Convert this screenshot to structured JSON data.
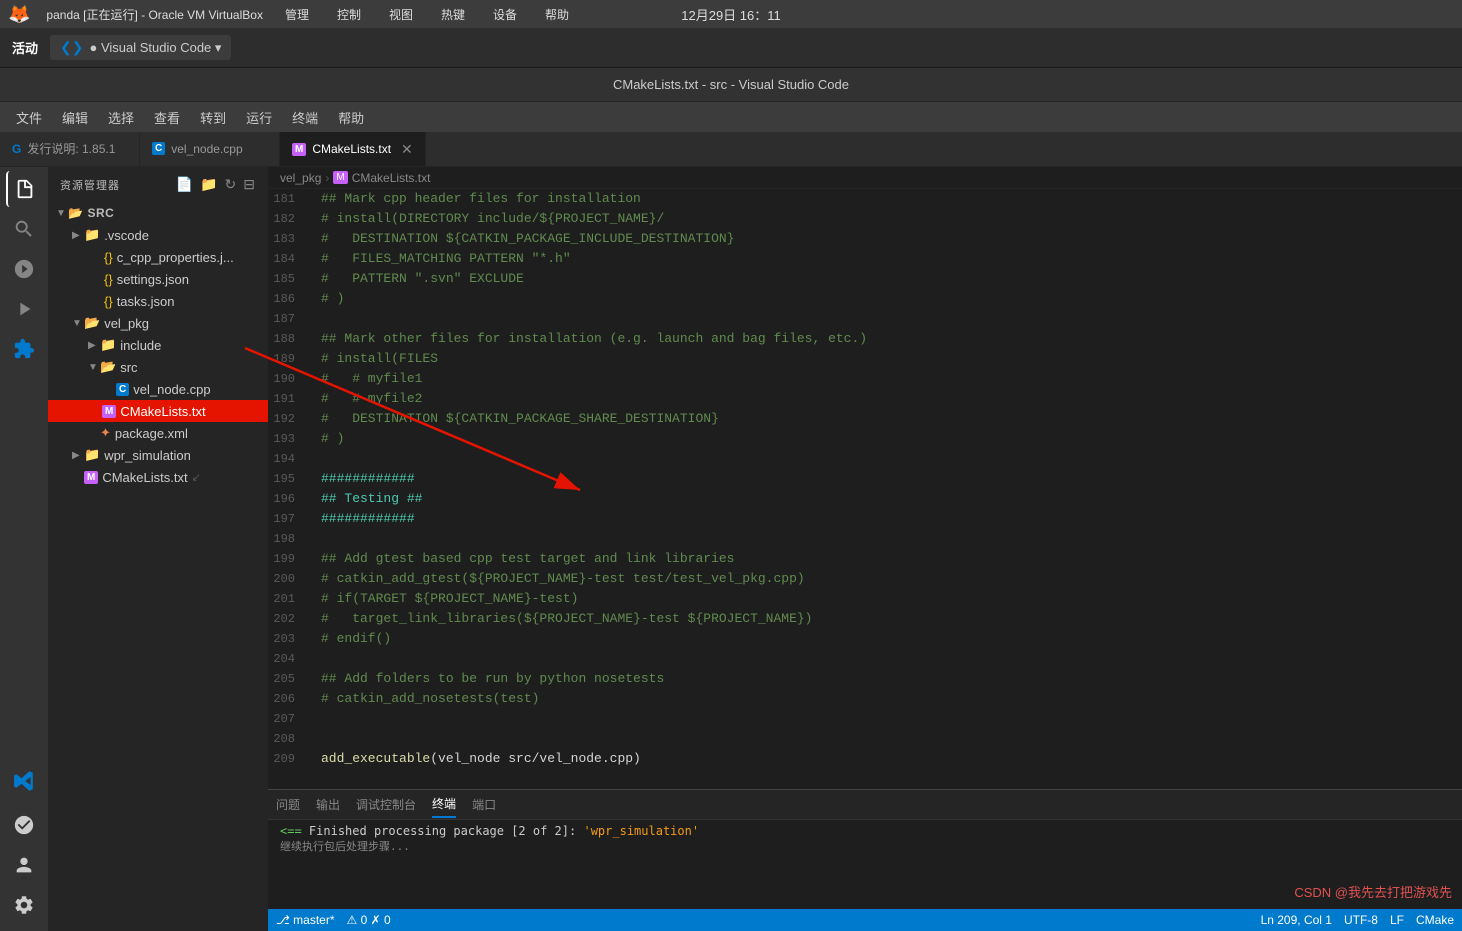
{
  "os": {
    "titlebar": "panda [正在运行] - Oracle VM VirtualBox",
    "menuItems": [
      "管理",
      "控制",
      "视图",
      "热键",
      "设备",
      "帮助"
    ],
    "appLabel": "活动",
    "vscodeBadge": "● Visual Studio Code ▾",
    "datetime": "12月29日  16：11",
    "windowTitle": "CMakeLists.txt - src - Visual Studio Code"
  },
  "vscode": {
    "menuItems": [
      "文件",
      "编辑",
      "选择",
      "查看",
      "转到",
      "运行",
      "终端",
      "帮助"
    ],
    "tabs": [
      {
        "id": "release-notes",
        "label": "发行说明: 1.85.1",
        "icon": "G",
        "iconColor": "#007acc",
        "active": false,
        "closable": false
      },
      {
        "id": "vel-node",
        "label": "vel_node.cpp",
        "icon": "C",
        "iconColor": "#007acc",
        "active": false,
        "closable": false
      },
      {
        "id": "cmake",
        "label": "CMakeLists.txt",
        "icon": "M",
        "iconColor": "#c561f6",
        "active": true,
        "closable": true
      }
    ],
    "sidebar": {
      "title": "资源管理器",
      "root": "SRC",
      "tree": [
        {
          "indent": 0,
          "expanded": true,
          "name": "SRC",
          "type": "folder",
          "icon": "▼"
        },
        {
          "indent": 1,
          "expanded": true,
          "name": ".vscode",
          "type": "folder",
          "icon": "▶"
        },
        {
          "indent": 2,
          "name": "c_cpp_properties.j...",
          "type": "json",
          "icon": "{}"
        },
        {
          "indent": 2,
          "name": "settings.json",
          "type": "json",
          "icon": "{}"
        },
        {
          "indent": 2,
          "name": "tasks.json",
          "type": "json",
          "icon": "{}"
        },
        {
          "indent": 1,
          "expanded": true,
          "name": "vel_pkg",
          "type": "folder",
          "icon": "▼"
        },
        {
          "indent": 2,
          "name": "include",
          "type": "folder",
          "icon": "▶"
        },
        {
          "indent": 2,
          "expanded": true,
          "name": "src",
          "type": "folder",
          "icon": "▼"
        },
        {
          "indent": 3,
          "name": "vel_node.cpp",
          "type": "cpp",
          "icon": "C"
        },
        {
          "indent": 2,
          "name": "CMakeLists.txt",
          "type": "cmake",
          "icon": "M",
          "selected": true,
          "highlighted": true
        },
        {
          "indent": 2,
          "name": "package.xml",
          "type": "xml",
          "icon": "✦"
        },
        {
          "indent": 1,
          "name": "wpr_simulation",
          "type": "folder",
          "icon": "▶"
        },
        {
          "indent": 0,
          "name": "CMakeLists.txt",
          "type": "cmake",
          "icon": "M"
        }
      ]
    },
    "breadcrumb": [
      "vel_pkg",
      ">",
      "M CMakeLists.txt"
    ],
    "editor": {
      "lines": [
        {
          "num": 181,
          "text": "## Mark cpp header files for installation",
          "class": "c-comment"
        },
        {
          "num": 182,
          "text": "# install(DIRECTORY include/${PROJECT_NAME}/",
          "class": "c-comment"
        },
        {
          "num": 183,
          "text": "#   DESTINATION ${CATKIN_PACKAGE_INCLUDE_DESTINATION}",
          "class": "c-comment"
        },
        {
          "num": 184,
          "text": "#   FILES_MATCHING PATTERN \"*.h\"",
          "class": "c-comment"
        },
        {
          "num": 185,
          "text": "#   PATTERN \".svn\" EXCLUDE",
          "class": "c-comment"
        },
        {
          "num": 186,
          "text": "# )",
          "class": "c-comment"
        },
        {
          "num": 187,
          "text": "",
          "class": ""
        },
        {
          "num": 188,
          "text": "## Mark other files for installation (e.g. launch and bag files, etc.)",
          "class": "c-comment"
        },
        {
          "num": 189,
          "text": "# install(FILES",
          "class": "c-comment"
        },
        {
          "num": 190,
          "text": "#   # myfile1",
          "class": "c-comment"
        },
        {
          "num": 191,
          "text": "#   # myfile2",
          "class": "c-comment"
        },
        {
          "num": 192,
          "text": "#   DESTINATION ${CATKIN_PACKAGE_SHARE_DESTINATION}",
          "class": "c-comment"
        },
        {
          "num": 193,
          "text": "# )",
          "class": "c-comment"
        },
        {
          "num": 194,
          "text": "",
          "class": ""
        },
        {
          "num": 195,
          "text": "############",
          "class": "c-hash"
        },
        {
          "num": 196,
          "text": "## Testing ##",
          "class": "c-hash"
        },
        {
          "num": 197,
          "text": "############",
          "class": "c-hash"
        },
        {
          "num": 198,
          "text": "",
          "class": ""
        },
        {
          "num": 199,
          "text": "## Add gtest based cpp test target and link libraries",
          "class": "c-comment"
        },
        {
          "num": 200,
          "text": "# catkin_add_gtest(${PROJECT_NAME}-test test/test_vel_pkg.cpp)",
          "class": "c-comment"
        },
        {
          "num": 201,
          "text": "# if(TARGET ${PROJECT_NAME}-test)",
          "class": "c-comment"
        },
        {
          "num": 202,
          "text": "#   target_link_libraries(${PROJECT_NAME}-test ${PROJECT_NAME})",
          "class": "c-comment"
        },
        {
          "num": 203,
          "text": "# endif()",
          "class": "c-comment"
        },
        {
          "num": 204,
          "text": "",
          "class": ""
        },
        {
          "num": 205,
          "text": "## Add folders to be run by python nosetests",
          "class": "c-comment"
        },
        {
          "num": 206,
          "text": "# catkin_add_nosetests(test)",
          "class": "c-comment"
        },
        {
          "num": 207,
          "text": "",
          "class": ""
        },
        {
          "num": 208,
          "text": "",
          "class": ""
        },
        {
          "num": 209,
          "text": "add_executable(vel_node src/vel_node.cpp)",
          "class": "c-white"
        }
      ]
    },
    "terminal": {
      "tabs": [
        "问题",
        "输出",
        "调试控制台",
        "终端",
        "端口"
      ],
      "activeTab": "终端",
      "content": "<== Finished processing package [2 of 2]: 'wpr_simulation'"
    },
    "statusbar": {
      "left": [
        "⎇ master*",
        "⚠ 0",
        "✗ 0"
      ],
      "right": [
        "Ln 209, Col 1",
        "UTF-8",
        "LF",
        "CMake"
      ]
    },
    "activityIcons": [
      "files",
      "search",
      "git",
      "run",
      "extensions",
      "vscode"
    ],
    "csdn": "CSDN @我先去打把游戏先"
  }
}
